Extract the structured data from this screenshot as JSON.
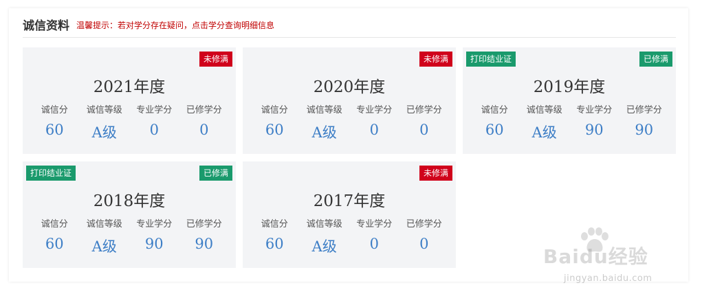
{
  "header": {
    "title": "诚信资料",
    "tip": "温馨提示：若对学分存在疑问，点击学分查询明细信息"
  },
  "stat_labels": [
    "诚信分",
    "诚信等级",
    "专业学分",
    "已修学分"
  ],
  "colors": {
    "badge_red": "#d0021b",
    "badge_green": "#1a9a6c",
    "value_blue": "#3d7ec6",
    "tip_red": "#c00000"
  },
  "cards": [
    {
      "year": "2021年度",
      "status": "未修满",
      "status_color": "red",
      "print_label": null,
      "values": [
        "60",
        "A级",
        "0",
        "0"
      ]
    },
    {
      "year": "2020年度",
      "status": "未修满",
      "status_color": "red",
      "print_label": null,
      "values": [
        "60",
        "A级",
        "0",
        "0"
      ]
    },
    {
      "year": "2019年度",
      "status": "已修满",
      "status_color": "green",
      "print_label": "打印结业证",
      "values": [
        "60",
        "A级",
        "90",
        "90"
      ]
    },
    {
      "year": "2018年度",
      "status": "已修满",
      "status_color": "green",
      "print_label": "打印结业证",
      "values": [
        "60",
        "A级",
        "90",
        "90"
      ]
    },
    {
      "year": "2017年度",
      "status": "未修满",
      "status_color": "red",
      "print_label": null,
      "values": [
        "60",
        "A级",
        "0",
        "0"
      ]
    }
  ],
  "watermark": {
    "brand": "Baidu经验",
    "domain": "jingyan.baidu.com",
    "icon": "paw-icon"
  }
}
